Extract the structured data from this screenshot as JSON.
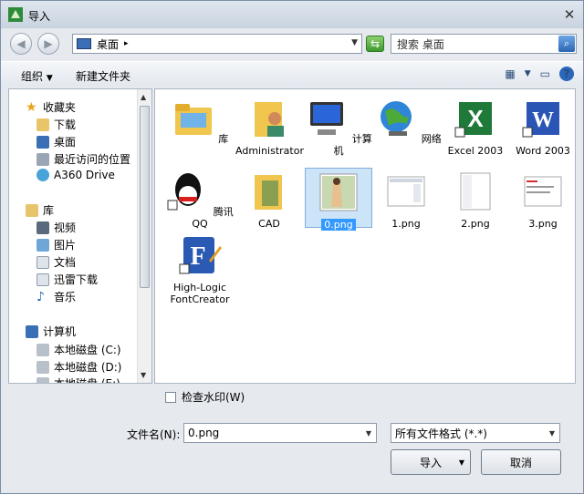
{
  "window": {
    "title": "导入"
  },
  "nav": {
    "location": "桌面",
    "search_placeholder": "搜索 桌面"
  },
  "toolbar": {
    "organize": "组织",
    "new_folder": "新建文件夹"
  },
  "sidebar": {
    "favorites": {
      "title": "收藏夹",
      "items": [
        "下载",
        "桌面",
        "最近访问的位置",
        "A360 Drive"
      ]
    },
    "libraries": {
      "title": "库",
      "items": [
        "视频",
        "图片",
        "文档",
        "迅雷下载",
        "音乐"
      ]
    },
    "computer": {
      "title": "计算机",
      "items": [
        "本地磁盘 (C:)",
        "本地磁盘 (D:)",
        "本地磁盘 (E:)"
      ]
    }
  },
  "files": [
    {
      "label": "库",
      "icon": "library-icon"
    },
    {
      "label": "Administrator",
      "icon": "user-folder-icon"
    },
    {
      "label": "计算机",
      "icon": "computer-icon"
    },
    {
      "label": "网络",
      "icon": "network-icon"
    },
    {
      "label": "Excel 2003",
      "icon": "excel-icon"
    },
    {
      "label": "Word 2003",
      "icon": "word-icon"
    },
    {
      "label": "腾讯QQ",
      "icon": "qq-icon"
    },
    {
      "label": "CAD",
      "icon": "folder-icon"
    },
    {
      "label": "0.png",
      "icon": "image-thumbnail",
      "selected": true
    },
    {
      "label": "1.png",
      "icon": "image-thumbnail"
    },
    {
      "label": "2.png",
      "icon": "image-thumbnail"
    },
    {
      "label": "3.png",
      "icon": "image-thumbnail"
    },
    {
      "label": "High-Logic FontCreator",
      "icon": "fontcreator-icon"
    }
  ],
  "options": {
    "check_watermark": "检查水印(W)"
  },
  "form": {
    "filename_label": "文件名(N):",
    "filename_value": "0.png",
    "filetype_value": "所有文件格式 (*.*)",
    "import_button": "导入",
    "cancel_button": "取消"
  },
  "colors": {
    "accent": "#3399ff",
    "selected_bg": "#cce4f7"
  }
}
